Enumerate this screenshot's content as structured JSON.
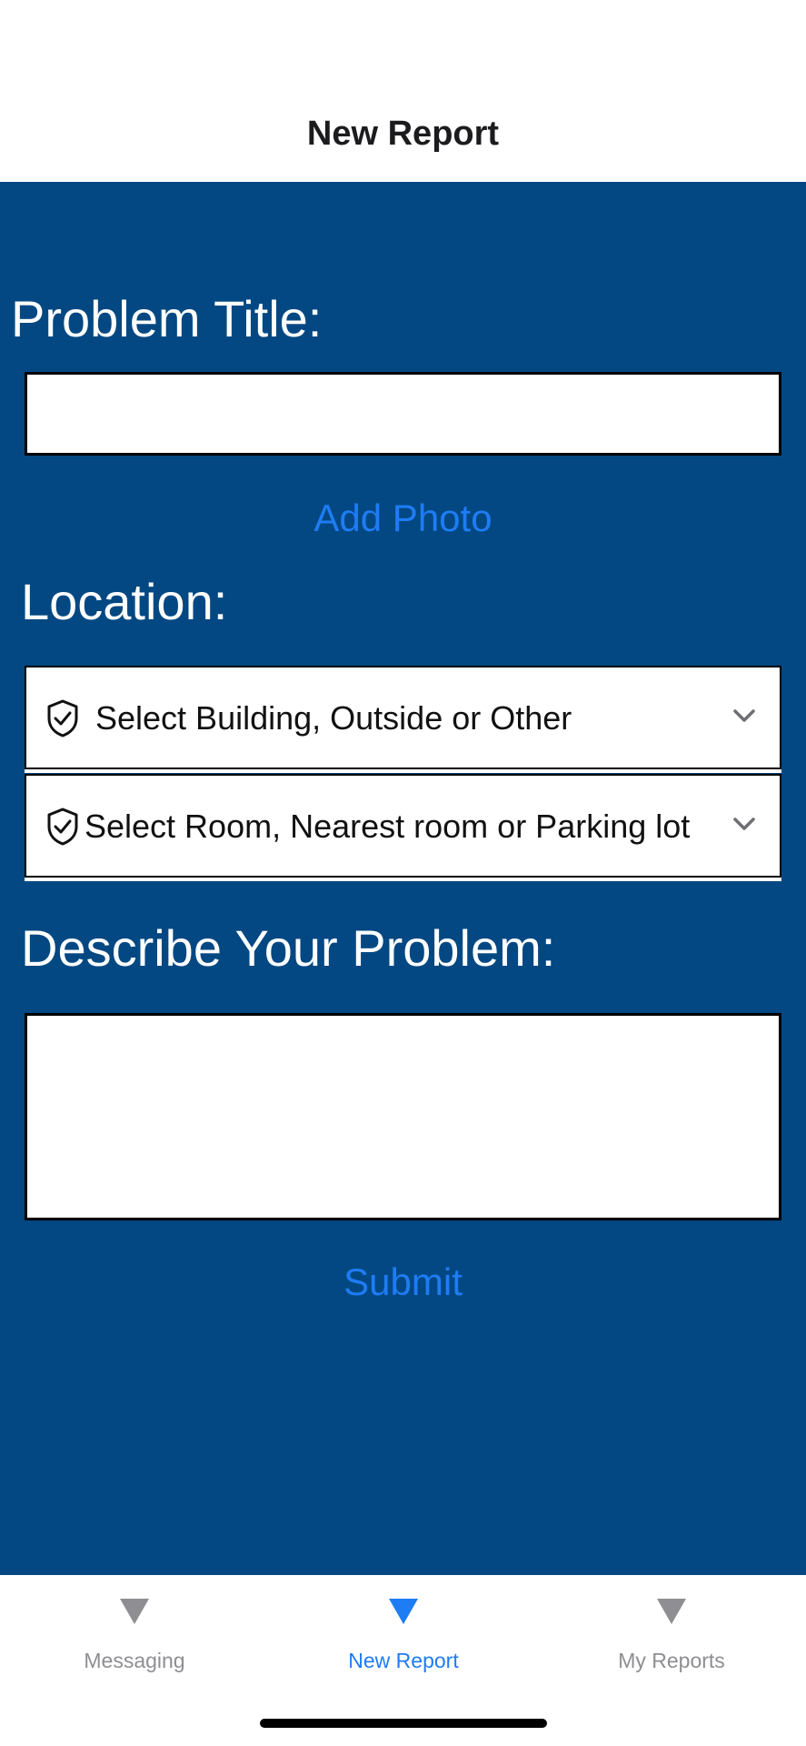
{
  "header": {
    "title": "New Report"
  },
  "form": {
    "problem_title_label": "Problem Title:",
    "problem_title_value": "",
    "add_photo_label": "Add Photo",
    "location_label": "Location:",
    "building_select_text": "Select Building, Outside or Other",
    "room_select_text": "Select Room, Nearest room or Parking lot",
    "describe_label": "Describe Your Problem:",
    "describe_value": "",
    "submit_label": "Submit"
  },
  "tabs": [
    {
      "label": "Messaging",
      "selected": false
    },
    {
      "label": "New Report",
      "selected": true
    },
    {
      "label": "My Reports",
      "selected": false
    }
  ],
  "icons": {
    "select": "shield-check-icon",
    "dropdown": "chevron-down-icon",
    "tab": "triangle-down-icon"
  },
  "colors": {
    "background": "#034882",
    "accent": "#1e7cf5",
    "tab_inactive": "#8e8e93"
  }
}
